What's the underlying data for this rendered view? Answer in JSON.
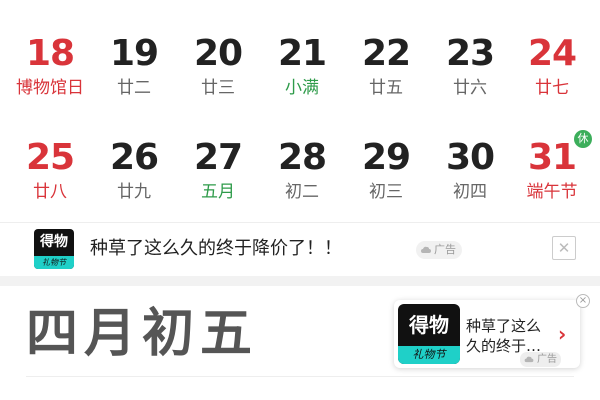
{
  "calendar": {
    "weeks": [
      [
        {
          "day": "18",
          "sub": "博物馆日",
          "style": "red"
        },
        {
          "day": "19",
          "sub": "廿二",
          "style": "normal"
        },
        {
          "day": "20",
          "sub": "廿三",
          "style": "normal"
        },
        {
          "day": "21",
          "sub": "小满",
          "style": "green"
        },
        {
          "day": "22",
          "sub": "廿五",
          "style": "normal"
        },
        {
          "day": "23",
          "sub": "廿六",
          "style": "normal"
        },
        {
          "day": "24",
          "sub": "廿七",
          "style": "red"
        }
      ],
      [
        {
          "day": "25",
          "sub": "廿八",
          "style": "red"
        },
        {
          "day": "26",
          "sub": "廿九",
          "style": "normal"
        },
        {
          "day": "27",
          "sub": "五月",
          "style": "green"
        },
        {
          "day": "28",
          "sub": "初二",
          "style": "normal"
        },
        {
          "day": "29",
          "sub": "初三",
          "style": "normal"
        },
        {
          "day": "30",
          "sub": "初四",
          "style": "normal"
        },
        {
          "day": "31",
          "sub": "端午节",
          "style": "red",
          "badge": "休"
        }
      ]
    ]
  },
  "ad_banner": {
    "logo_text": "得物",
    "logo_subtext": "礼物节",
    "text": "种草了这么久的终于降价了！！",
    "tag": "广告",
    "close_icon": "close-icon"
  },
  "lunar_date": "四月初五",
  "float_ad": {
    "logo_text": "得物",
    "logo_subtext": "礼物节",
    "text": "种草了这么久的终于…",
    "arrow": "›",
    "tag": "广告",
    "close": "×"
  },
  "colors": {
    "red": "#d9343a",
    "green": "#2e9b4a",
    "badge_green": "#3cae5b",
    "logo_teal": "#1fd0c8"
  }
}
